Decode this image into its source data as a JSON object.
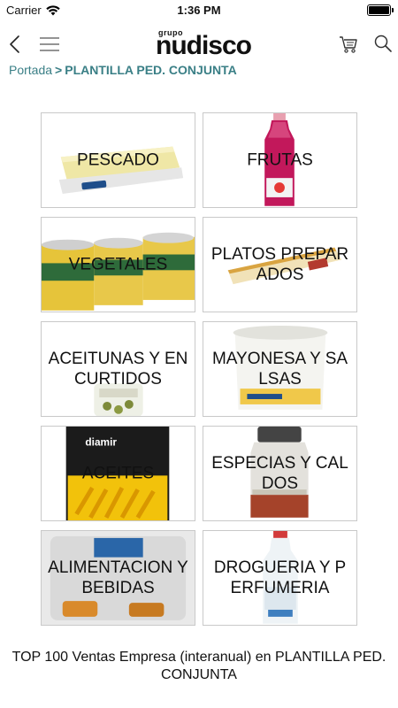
{
  "status_bar": {
    "carrier": "Carrier",
    "time": "1:36 PM",
    "wifi_icon": "wifi-icon",
    "battery_icon": "battery-icon",
    "battery_level": 1.0
  },
  "header": {
    "back_icon": "chevron-left-icon",
    "menu_icon": "hamburger-menu-icon",
    "logo_small": "grupo",
    "logo_main": "nudisco",
    "cart_icon": "shopping-cart-icon",
    "search_icon": "search-icon"
  },
  "breadcrumb": {
    "home": "Portada",
    "separator": ">",
    "current": "PLANTILLA PED. CONJUNTA"
  },
  "categories": [
    {
      "label": "PESCADO"
    },
    {
      "label": "FRUTAS"
    },
    {
      "label": "VEGETALES"
    },
    {
      "label": "PLATOS PREPARADOS"
    },
    {
      "label": "ACEITUNAS Y ENCURTIDOS"
    },
    {
      "label": "MAYONESA Y SALSAS"
    },
    {
      "label": "ACEITES",
      "brand": "diamir"
    },
    {
      "label": "ESPECIAS Y CALDOS"
    },
    {
      "label": "ALIMENTACION Y BEBIDAS"
    },
    {
      "label": "DROGUERIA Y PERFUMERIA"
    }
  ],
  "footer": {
    "text": "TOP 100 Ventas Empresa (interanual) en PLANTILLA PED. CONJUNTA"
  },
  "colors": {
    "accent": "#3a7f86",
    "tile_border": "#c9c9c9"
  }
}
